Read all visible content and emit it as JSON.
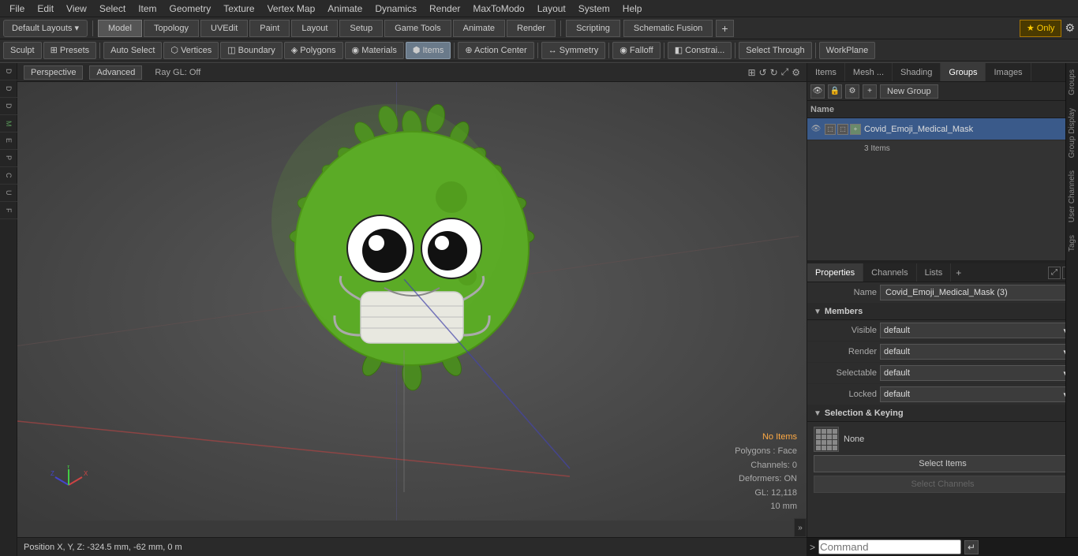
{
  "menubar": {
    "items": [
      "File",
      "Edit",
      "View",
      "Select",
      "Item",
      "Geometry",
      "Texture",
      "Vertex Map",
      "Animate",
      "Dynamics",
      "Render",
      "MaxToModo",
      "Layout",
      "System",
      "Help"
    ]
  },
  "toolbar1": {
    "layout_label": "Default Layouts ▾",
    "mode_tabs": [
      "Model",
      "Topology",
      "UVEdit",
      "Paint",
      "Layout",
      "Setup",
      "Game Tools",
      "Animate",
      "Render"
    ],
    "scripting": "Scripting",
    "schematic_fusion": "Schematic Fusion",
    "plus": "+",
    "star": "★  Only",
    "gear": "⚙"
  },
  "toolbar2": {
    "sculpt": "Sculpt",
    "presets": "⊞ Presets",
    "auto_select": "Auto Select",
    "vertices": "⬡ Vertices",
    "boundary": "◫ Boundary",
    "polygons": "◈ Polygons",
    "materials": "◉ Materials",
    "items": "⬢ Items",
    "action_center": "⊕ Action Center",
    "symmetry": "↔ Symmetry",
    "falloff": "◉ Falloff",
    "constraints": "◧ Constrai...",
    "select_through": "Select Through",
    "workplane": "WorkPlane"
  },
  "viewport": {
    "tabs": [
      "Perspective",
      "Advanced"
    ],
    "ray_gl": "Ray GL: Off",
    "info": {
      "no_items": "No Items",
      "polygons": "Polygons : Face",
      "channels": "Channels: 0",
      "deformers": "Deformers: ON",
      "gl": "GL: 12,118",
      "mm": "10 mm"
    }
  },
  "left_tabs": [
    "D",
    "D",
    "D",
    "M",
    "E",
    "P",
    "C",
    "U",
    "F"
  ],
  "right_panel": {
    "tabs": [
      "Items",
      "Mesh ...",
      "Shading",
      "Groups",
      "Images"
    ],
    "active_tab": "Groups",
    "new_group_btn": "New Group",
    "list_header": "Name",
    "item_name": "Covid_Emoji_Medical_Mask",
    "item_count": "(3)",
    "item_subtext": "3 Items",
    "properties": {
      "tabs": [
        "Properties",
        "Channels",
        "Lists"
      ],
      "name_label": "Name",
      "name_value": "Covid_Emoji_Medical_Mask (3)",
      "members_section": "Members",
      "visible_label": "Visible",
      "visible_value": "default",
      "render_label": "Render",
      "render_value": "default",
      "selectable_label": "Selectable",
      "selectable_value": "default",
      "locked_label": "Locked",
      "locked_value": "default",
      "sel_keying_section": "Selection & Keying",
      "none_label": "None",
      "select_items_btn": "Select Items",
      "select_channels_btn": "Select Channels"
    }
  },
  "right_vtabs": [
    "Groups",
    "Group Display",
    "User Channels",
    "Tags"
  ],
  "position": "Position X, Y, Z:  -324.5 mm, -62 mm, 0 m",
  "command": "Command",
  "command_arrow": ">"
}
